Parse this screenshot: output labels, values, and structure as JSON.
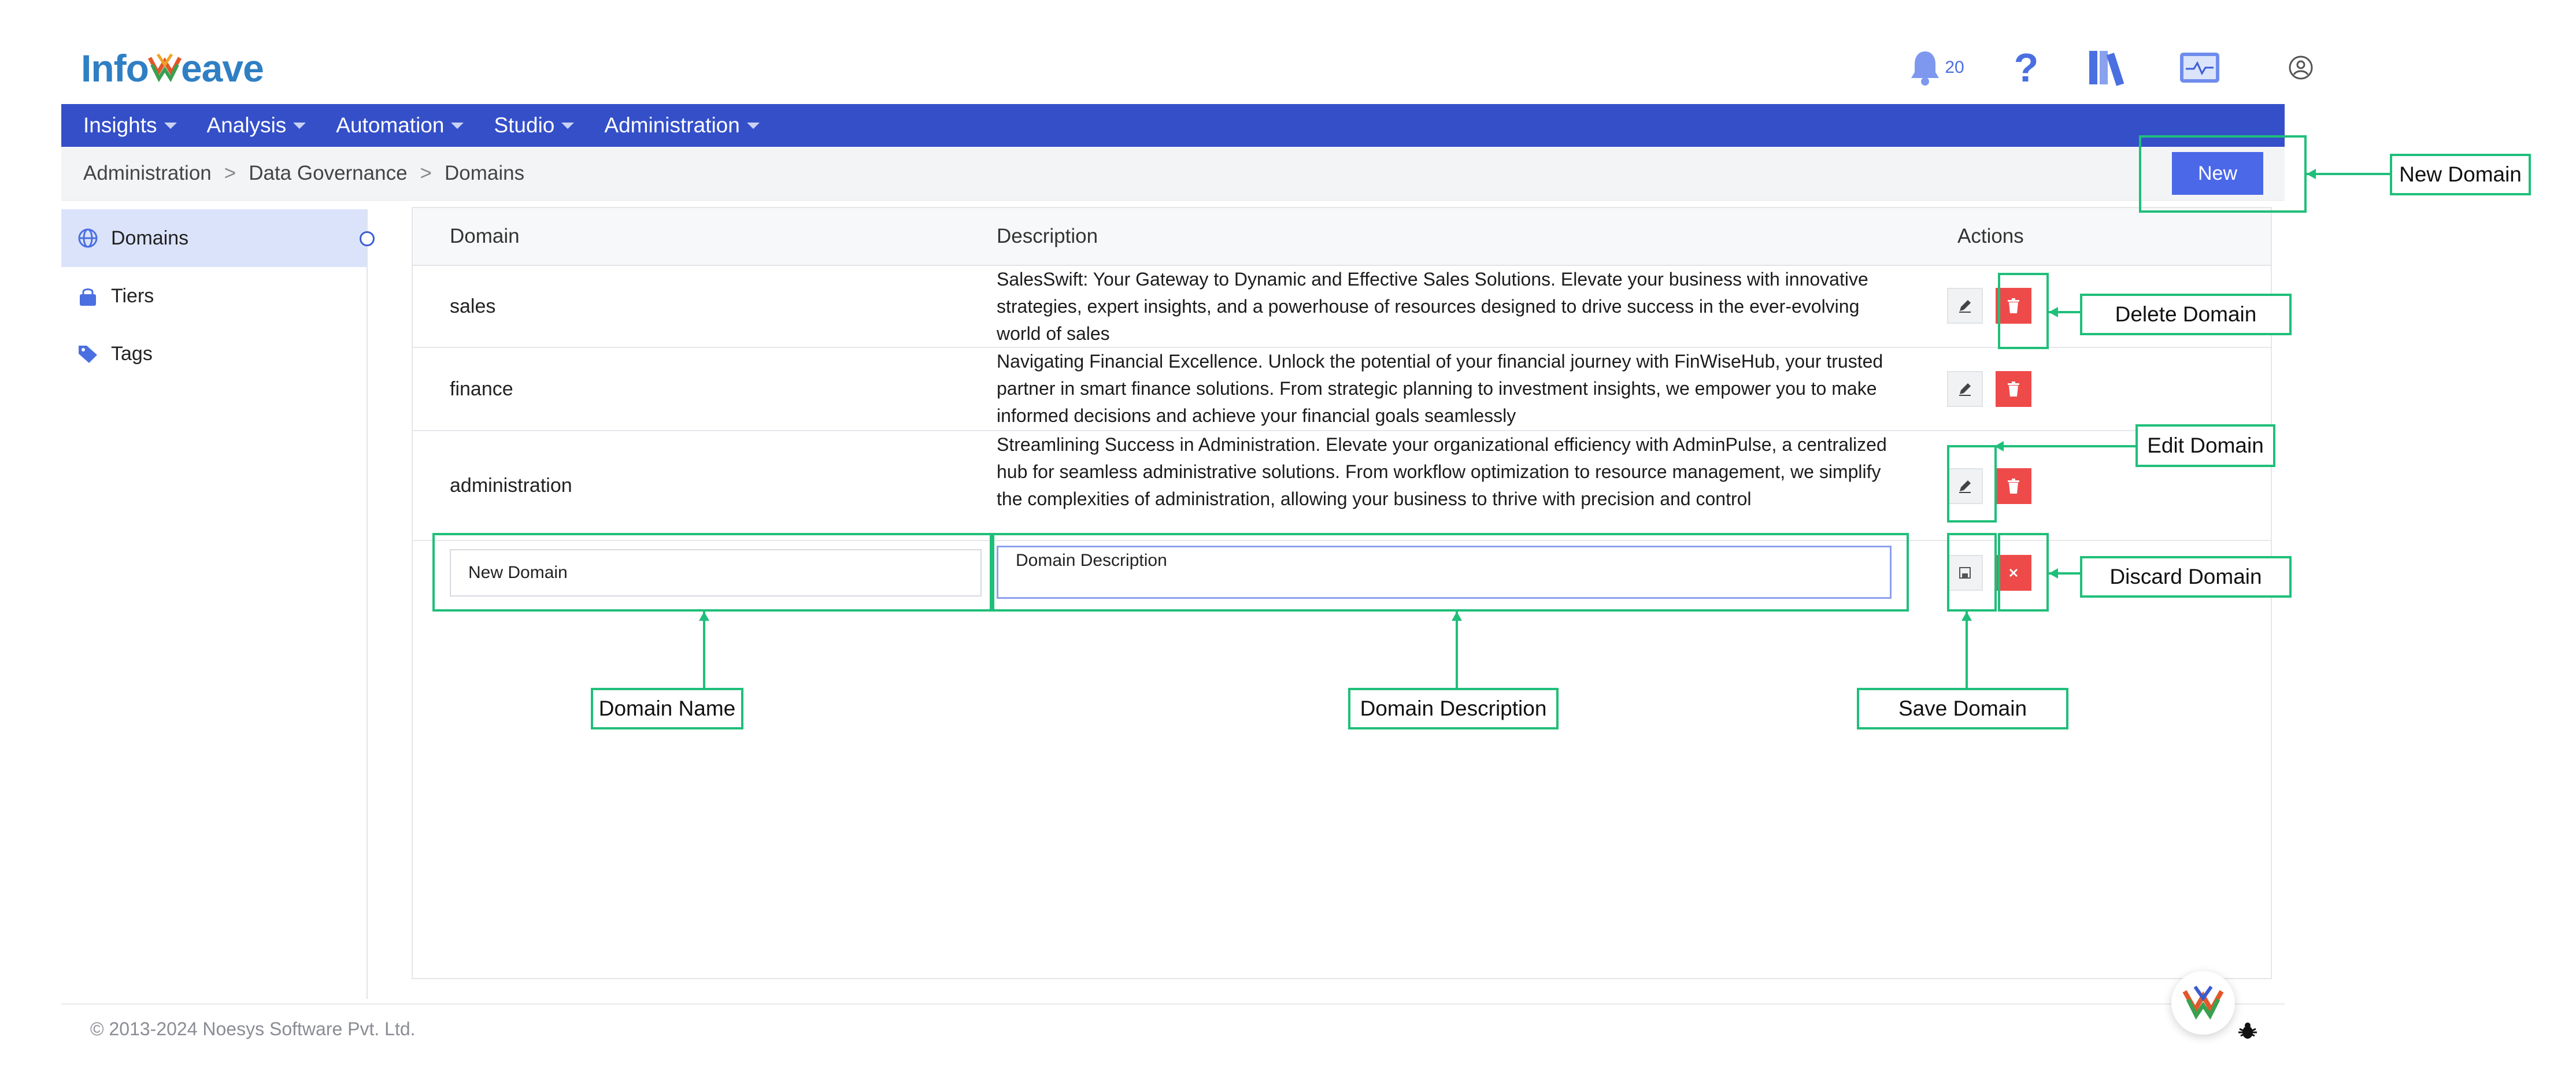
{
  "app": {
    "logo_left": "Info",
    "logo_right": "eave",
    "notification_count": "20",
    "help_glyph": "?"
  },
  "nav": {
    "items": [
      {
        "label": "Insights"
      },
      {
        "label": "Analysis"
      },
      {
        "label": "Automation"
      },
      {
        "label": "Studio"
      },
      {
        "label": "Administration"
      }
    ]
  },
  "breadcrumb": {
    "items": [
      "Administration",
      "Data Governance",
      "Domains"
    ],
    "separator": ">"
  },
  "toolbar": {
    "new_label": "New"
  },
  "sidebar": {
    "items": [
      {
        "label": "Domains",
        "icon": "globe-icon"
      },
      {
        "label": "Tiers",
        "icon": "lock-icon"
      },
      {
        "label": "Tags",
        "icon": "tag-icon"
      }
    ]
  },
  "table": {
    "headers": {
      "domain": "Domain",
      "description": "Description",
      "actions": "Actions"
    },
    "rows": [
      {
        "name": "sales",
        "description": "SalesSwift: Your Gateway to Dynamic and Effective Sales Solutions. Elevate your business with innovative strategies, expert insights, and a powerhouse of resources designed to drive success in the ever-evolving world of sales"
      },
      {
        "name": "finance",
        "description": "Navigating Financial Excellence. Unlock the potential of your financial journey with FinWiseHub, your trusted partner in smart finance solutions. From strategic planning to investment insights, we empower you to make informed decisions and achieve your financial goals seamlessly"
      },
      {
        "name": "administration",
        "description": "Streamlining Success in Administration. Elevate your organizational efficiency with AdminPulse, a centralized hub for seamless administrative solutions. From workflow optimization to resource management, we simplify the complexities of administration, allowing your business to thrive with precision and control"
      }
    ],
    "new_row": {
      "name_value": "New Domain",
      "description_value": "Domain Description"
    }
  },
  "annotations": {
    "new_domain": "New Domain",
    "delete_domain": "Delete Domain",
    "edit_domain": "Edit Domain",
    "discard_domain": "Discard Domain",
    "domain_name": "Domain Name",
    "domain_description": "Domain Description",
    "save_domain": "Save Domain"
  },
  "footer": {
    "copyright": "© 2013-2024 Noesys Software Pvt. Ltd."
  },
  "colors": {
    "nav_bg": "#344fc8",
    "primary_button": "#4a68e8",
    "delete_button": "#ee4a4a",
    "annotation": "#1fbf7a",
    "active_sidebar": "#dbe3fb"
  }
}
